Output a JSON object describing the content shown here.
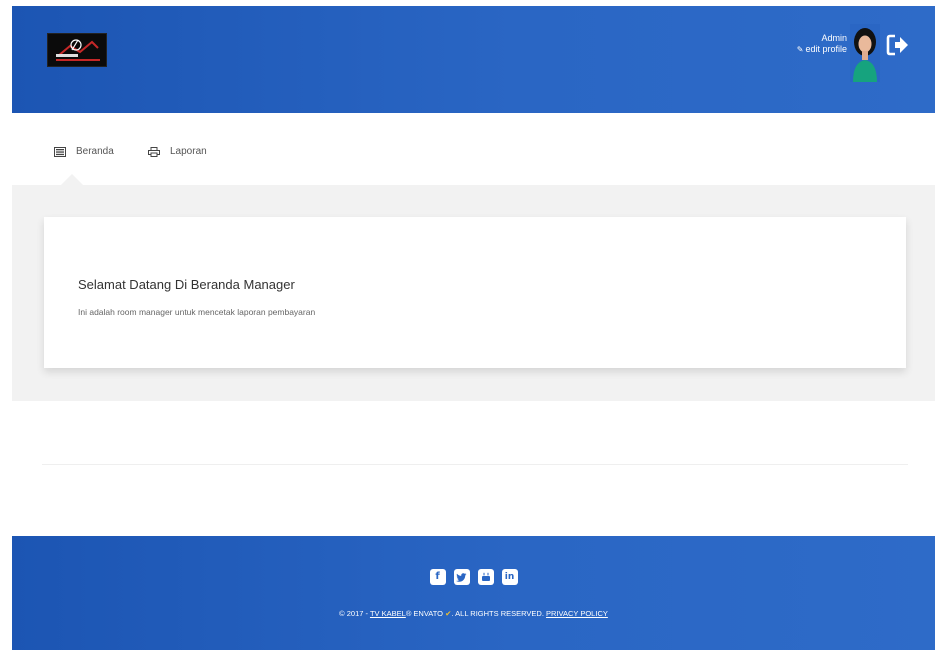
{
  "header": {
    "user_name": "Admin",
    "edit_profile_label": "edit profile",
    "logo_alt_text": "TV KABEL"
  },
  "nav": {
    "items": [
      {
        "label": "Beranda",
        "icon": "list-icon",
        "active": true
      },
      {
        "label": "Laporan",
        "icon": "printer-icon",
        "active": false
      }
    ]
  },
  "main": {
    "title": "Selamat Datang Di Beranda Manager",
    "description": "Ini adalah room manager untuk mencetak laporan pembayaran"
  },
  "footer": {
    "social_icons": [
      "facebook-icon",
      "twitter-icon",
      "youtube-icon",
      "linkedin-icon"
    ],
    "copyright_prefix": "© 2017 - ",
    "brand_link": "TV KABEL",
    "copyright_mid": "® ENVATO",
    "copyright_rights": ". ALL RIGHTS RESERVED. ",
    "privacy_link": "PRIVACY POLICY"
  },
  "colors": {
    "header_blue": "#2a66c4",
    "band_gray": "#f2f2f2"
  }
}
